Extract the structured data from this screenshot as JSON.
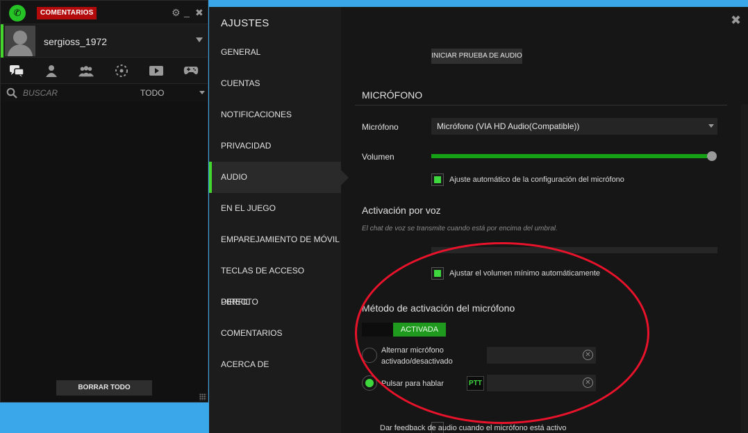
{
  "colors": {
    "accent": "#44d62c",
    "badge": "#b30b0b",
    "annotation": "#e8132b"
  },
  "left_panel": {
    "badge": "COMENTARIOS",
    "window_icons": [
      "gear-icon",
      "minimize-icon",
      "close-icon"
    ],
    "username": "sergioss_1972",
    "tab_icons": [
      "chat-icon",
      "user-icon",
      "group-icon",
      "radar-icon",
      "video-icon",
      "gamepad-icon"
    ],
    "search_placeholder": "BUSCAR",
    "filter": "TODO",
    "clear_button": "BORRAR TODO"
  },
  "settings": {
    "title": "AJUSTES",
    "nav": [
      "GENERAL",
      "CUENTAS",
      "NOTIFICACIONES",
      "PRIVACIDAD",
      "AUDIO",
      "EN EL JUEGO",
      "EMPAREJAMIENTO DE MÓVIL",
      "TECLAS DE ACCESO DIRECTO",
      "PERFIL",
      "COMENTARIOS",
      "ACERCA DE"
    ],
    "active_nav": "AUDIO",
    "audio": {
      "test_button": "INICIAR PRUEBA DE AUDIO",
      "mic_section_title": "MICRÓFONO",
      "mic_label": "Micrófono",
      "mic_value": "Micrófono (VIA HD Audio(Compatible))",
      "volume_label": "Volumen",
      "volume_level_percent": 100,
      "auto_adjust_label": "Ajuste automático de la configuración del micrófono",
      "auto_adjust_checked": true,
      "voice_title": "Activación por voz",
      "voice_desc": "El chat de voz se transmite cuando está por encima del umbral.",
      "min_volume_label": "Ajustar el volumen mínimo automáticamente",
      "min_volume_checked": true,
      "method_title": "Método de activación del micrófono",
      "toggle_label": "ACTIVADA",
      "option_toggle_line1": "Alternar micrófono",
      "option_toggle_line2": "activado/desactivado",
      "option_ptt": "Pulsar para hablar",
      "ptt_key": "PTT",
      "feedback_label": "Dar feedback de audio cuando el micrófono está activo",
      "feedback_checked": false
    }
  }
}
